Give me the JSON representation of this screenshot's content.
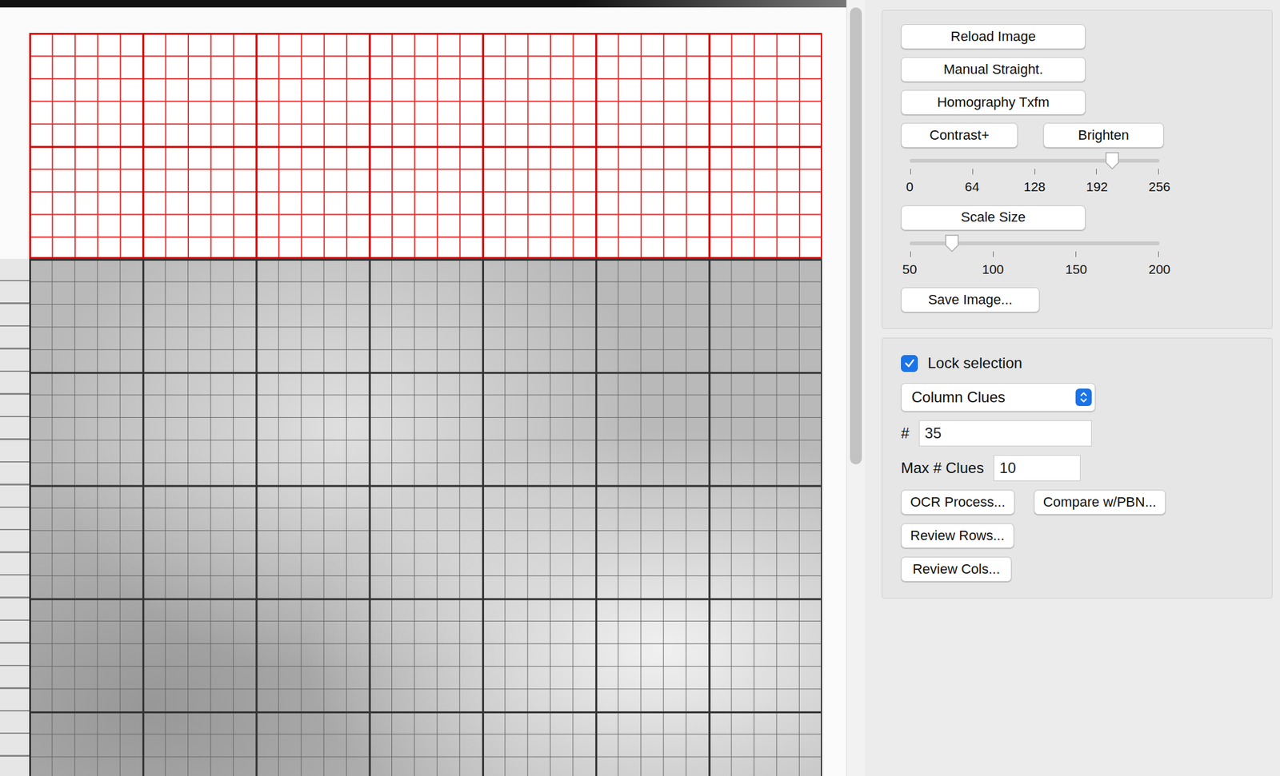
{
  "scrollbar": {
    "level": 0.6
  },
  "toolbar_buttons": [
    "Reload Image",
    "Manual Straight.",
    "Homography Txfm"
  ],
  "adjust_buttons": [
    "Contrast+",
    "Brighten"
  ],
  "brightness_slider": {
    "level": 0.81,
    "ticks": [
      "0",
      "64",
      "128",
      "192",
      "256"
    ]
  },
  "scale_button": "Scale Size",
  "scale_slider": {
    "level": 0.17,
    "ticks": [
      "50",
      "100",
      "150",
      "200"
    ]
  },
  "save_button": "Save Image...",
  "lock_selection": {
    "label": "Lock selection",
    "checked": true
  },
  "clue_type": {
    "value": "Column Clues"
  },
  "number_field": {
    "label": "#",
    "value": "35"
  },
  "max_clues_field": {
    "label": "Max # Clues",
    "value": "10"
  },
  "action_buttons": [
    [
      "OCR Process...",
      "Compare w/PBN..."
    ],
    [
      "Review Rows..."
    ],
    [
      "Review Cols..."
    ]
  ]
}
